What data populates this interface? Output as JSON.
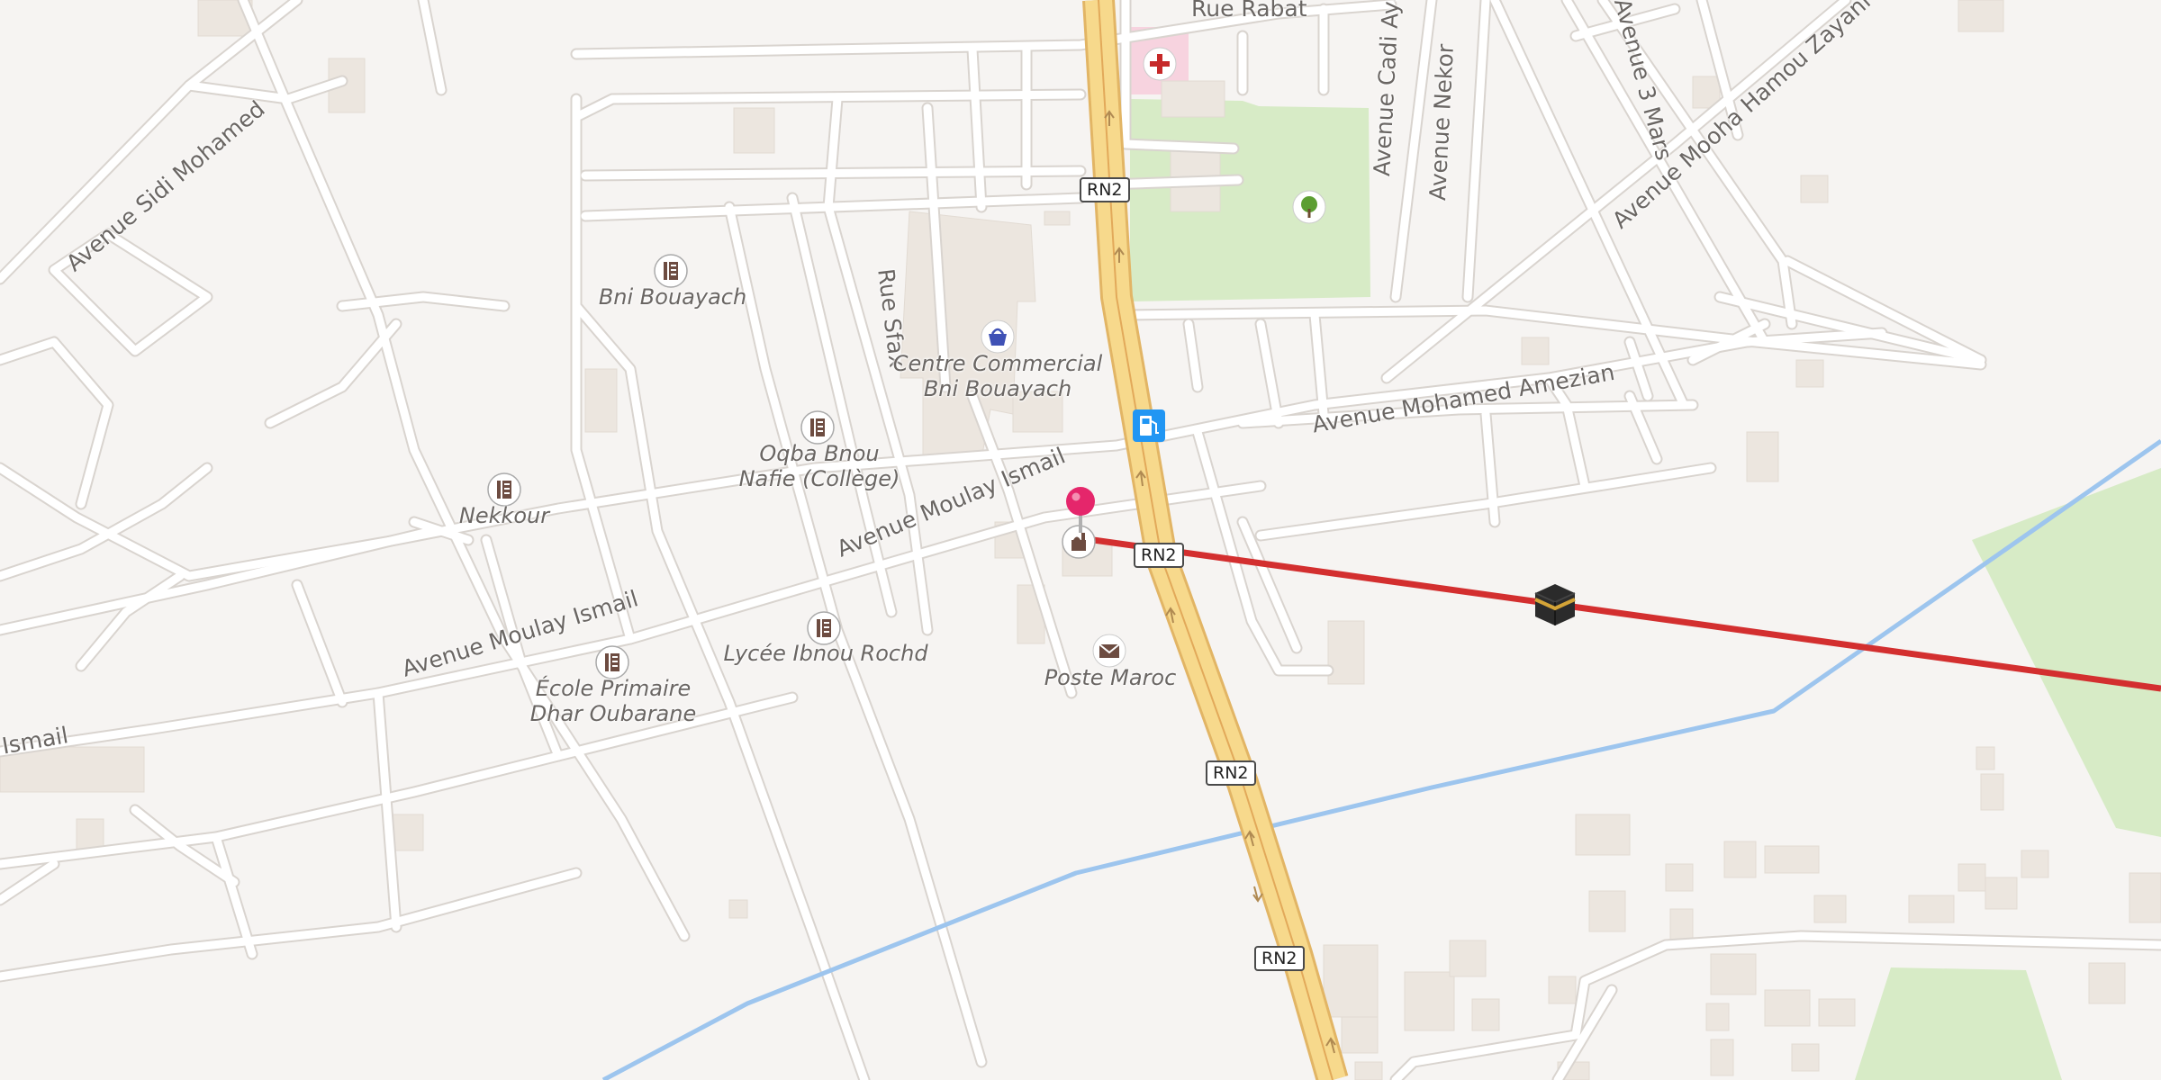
{
  "streets": {
    "rue_rabat": "Rue Rabat",
    "avenue_sidi_mohamed": "Avenue Sidi Mohamed",
    "rue_sfax": "Rue Sfax",
    "avenue_cadi_ayad": "Avenue Cadi Aya",
    "avenue_nekor": "Avenue Nekor",
    "avenue_3_mars": "Avenue 3 Mars",
    "avenue_mooha": "Avenue Mooha Hamou Zayani",
    "avenue_mohamed_amezian": "Avenue Mohamed Amezian",
    "avenue_moulay_ismail_1": "Avenue Moulay Ismail",
    "avenue_moulay_ismail_2": "Avenue Moulay Ismail",
    "avenue_moulay_ismail_3": "Ismail"
  },
  "road_shields": [
    "RN2",
    "RN2",
    "RN2",
    "RN2"
  ],
  "pois": {
    "bni_bouayach": "Bni Bouayach",
    "centre_commercial_line1": "Centre Commercial",
    "centre_commercial_line2": "Bni Bouayach",
    "oqba_line1": "Oqba Bnou",
    "oqba_line2": "Nafie (Collège)",
    "nekkour": "Nekkour",
    "lycee": "Lycée Ibnou Rochd",
    "ecole_line1": "École Primaire",
    "ecole_line2": "Dhar Oubarane",
    "poste": "Poste Maroc"
  },
  "icons": {
    "school": "school-icon",
    "shopping": "shopping-bag-icon",
    "hospital": "hospital-icon",
    "park": "tree-icon",
    "fuel": "fuel-icon",
    "post": "mail-icon",
    "mosque": "mosque-icon",
    "kaaba": "kaaba-icon",
    "pin": "location-pin-icon"
  },
  "colors": {
    "background": "#f6f4f2",
    "road": "#ffffff",
    "road_outline": "#d9d4cf",
    "highway": "#f7d98c",
    "highway_outline": "#e2b565",
    "building": "#ece6df",
    "park": "#d7ebc6",
    "river": "#9dc5ee",
    "qibla_line": "#d32f2f",
    "pin": "#e5266b"
  }
}
